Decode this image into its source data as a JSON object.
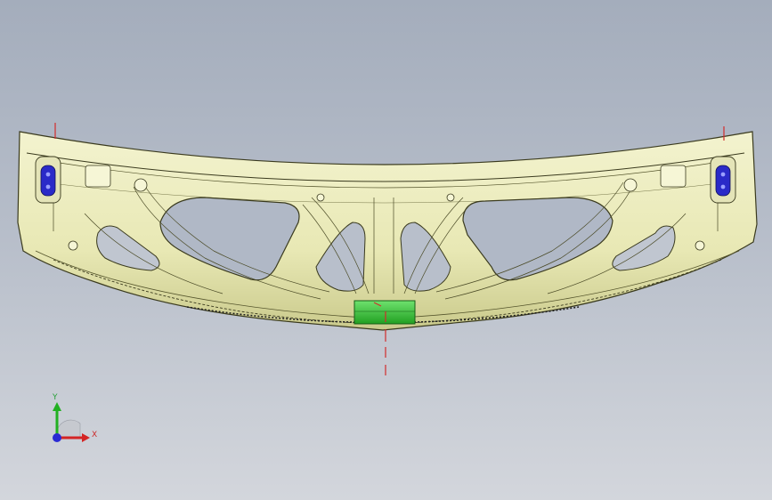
{
  "app": {
    "window": "cad-3d-viewport"
  },
  "model": {
    "part": "bumper-reinforcement-panel",
    "colors": {
      "surface": "#efefc2",
      "surface_shade": "#c8c890",
      "edge": "#3a3a1e",
      "highlight_face": "#3fd43f",
      "hole_face": "#2a2ac8",
      "ref_marker": "#d22c2c"
    }
  },
  "triad": {
    "x_label": "X",
    "y_label": "Y",
    "colors": {
      "x": "#d42424",
      "y": "#22b022",
      "z": "#2a2ad4"
    }
  }
}
